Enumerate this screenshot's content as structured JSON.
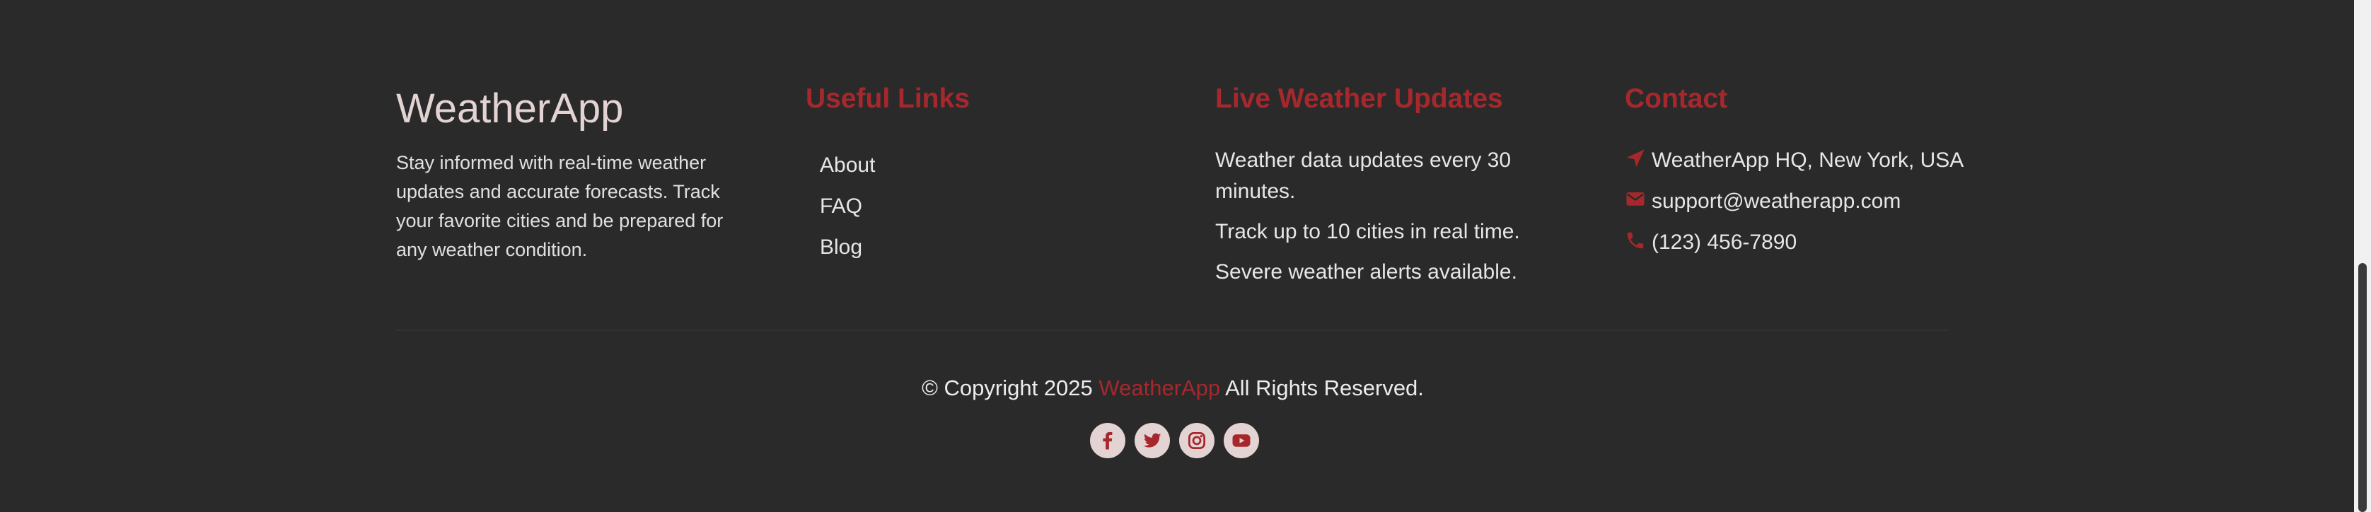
{
  "brand": {
    "title": "WeatherApp",
    "description": "Stay informed with real-time weather updates and accurate forecasts. Track your favorite cities and be prepared for any weather condition."
  },
  "useful_links": {
    "title": "Useful Links",
    "items": [
      "About",
      "FAQ",
      "Blog"
    ]
  },
  "live_updates": {
    "title": "Live Weather Updates",
    "items": [
      "Weather data updates every 30 minutes.",
      "Track up to 10 cities in real time.",
      "Severe weather alerts available."
    ]
  },
  "contact": {
    "title": "Contact",
    "items": [
      {
        "icon": "location-arrow-icon",
        "text": "WeatherApp HQ, New York, USA"
      },
      {
        "icon": "envelope-icon",
        "text": "support@weatherapp.com"
      },
      {
        "icon": "phone-icon",
        "text": "(123) 456-7890"
      }
    ]
  },
  "copyright": {
    "prefix": "© Copyright 2025",
    "brand": "WeatherApp",
    "suffix": "All Rights Reserved."
  },
  "social": [
    "facebook-icon",
    "twitter-icon",
    "instagram-icon",
    "youtube-icon"
  ],
  "colors": {
    "background": "#2a2a2a",
    "accent": "#a6282d",
    "heading_light": "#e4d3d3",
    "text": "#e6e6e6"
  }
}
